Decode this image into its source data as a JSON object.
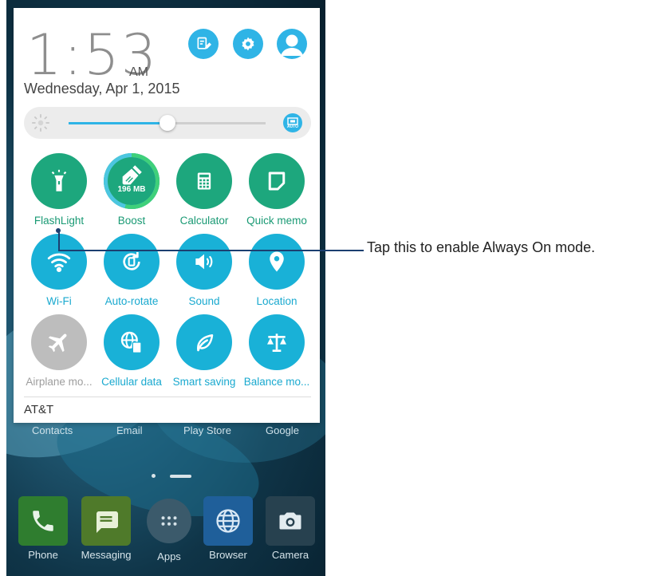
{
  "status": {
    "time": "1:53",
    "ampm": "AM",
    "date": "Wednesday, Apr 1, 2015"
  },
  "top_buttons": [
    {
      "icon": "edit-settings-icon"
    },
    {
      "icon": "gear-icon"
    },
    {
      "icon": "user-avatar-icon"
    }
  ],
  "brightness": {
    "level": 0.5,
    "auto_label": "AUTO"
  },
  "quick_settings": [
    {
      "label": "FlashLight",
      "icon": "flashlight-icon",
      "state": "green"
    },
    {
      "label": "Boost",
      "icon": "boost-icon",
      "state": "green",
      "badge": "196 MB"
    },
    {
      "label": "Calculator",
      "icon": "calculator-icon",
      "state": "green"
    },
    {
      "label": "Quick memo",
      "icon": "quick-memo-icon",
      "state": "green"
    },
    {
      "label": "Wi-Fi",
      "icon": "wifi-icon",
      "state": "blue"
    },
    {
      "label": "Auto-rotate",
      "icon": "auto-rotate-icon",
      "state": "blue"
    },
    {
      "label": "Sound",
      "icon": "sound-icon",
      "state": "blue"
    },
    {
      "label": "Location",
      "icon": "location-icon",
      "state": "blue"
    },
    {
      "label": "Airplane mo...",
      "icon": "airplane-icon",
      "state": "gray"
    },
    {
      "label": "Cellular data",
      "icon": "cellular-data-icon",
      "state": "blue"
    },
    {
      "label": "Smart saving",
      "icon": "smart-saving-icon",
      "state": "blue"
    },
    {
      "label": "Balance mo...",
      "icon": "balance-mode-icon",
      "state": "blue"
    }
  ],
  "carrier": "AT&T",
  "home": {
    "shortcuts": [
      "Contacts",
      "Email",
      "Play Store",
      "Google"
    ],
    "dock": [
      {
        "label": "Phone",
        "icon": "phone-icon"
      },
      {
        "label": "Messaging",
        "icon": "messaging-icon"
      },
      {
        "label": "Apps",
        "icon": "apps-grid-icon"
      },
      {
        "label": "Browser",
        "icon": "browser-globe-icon"
      },
      {
        "label": "Camera",
        "icon": "camera-icon"
      }
    ]
  },
  "callout": {
    "text": "Tap this to enable Always On mode."
  }
}
